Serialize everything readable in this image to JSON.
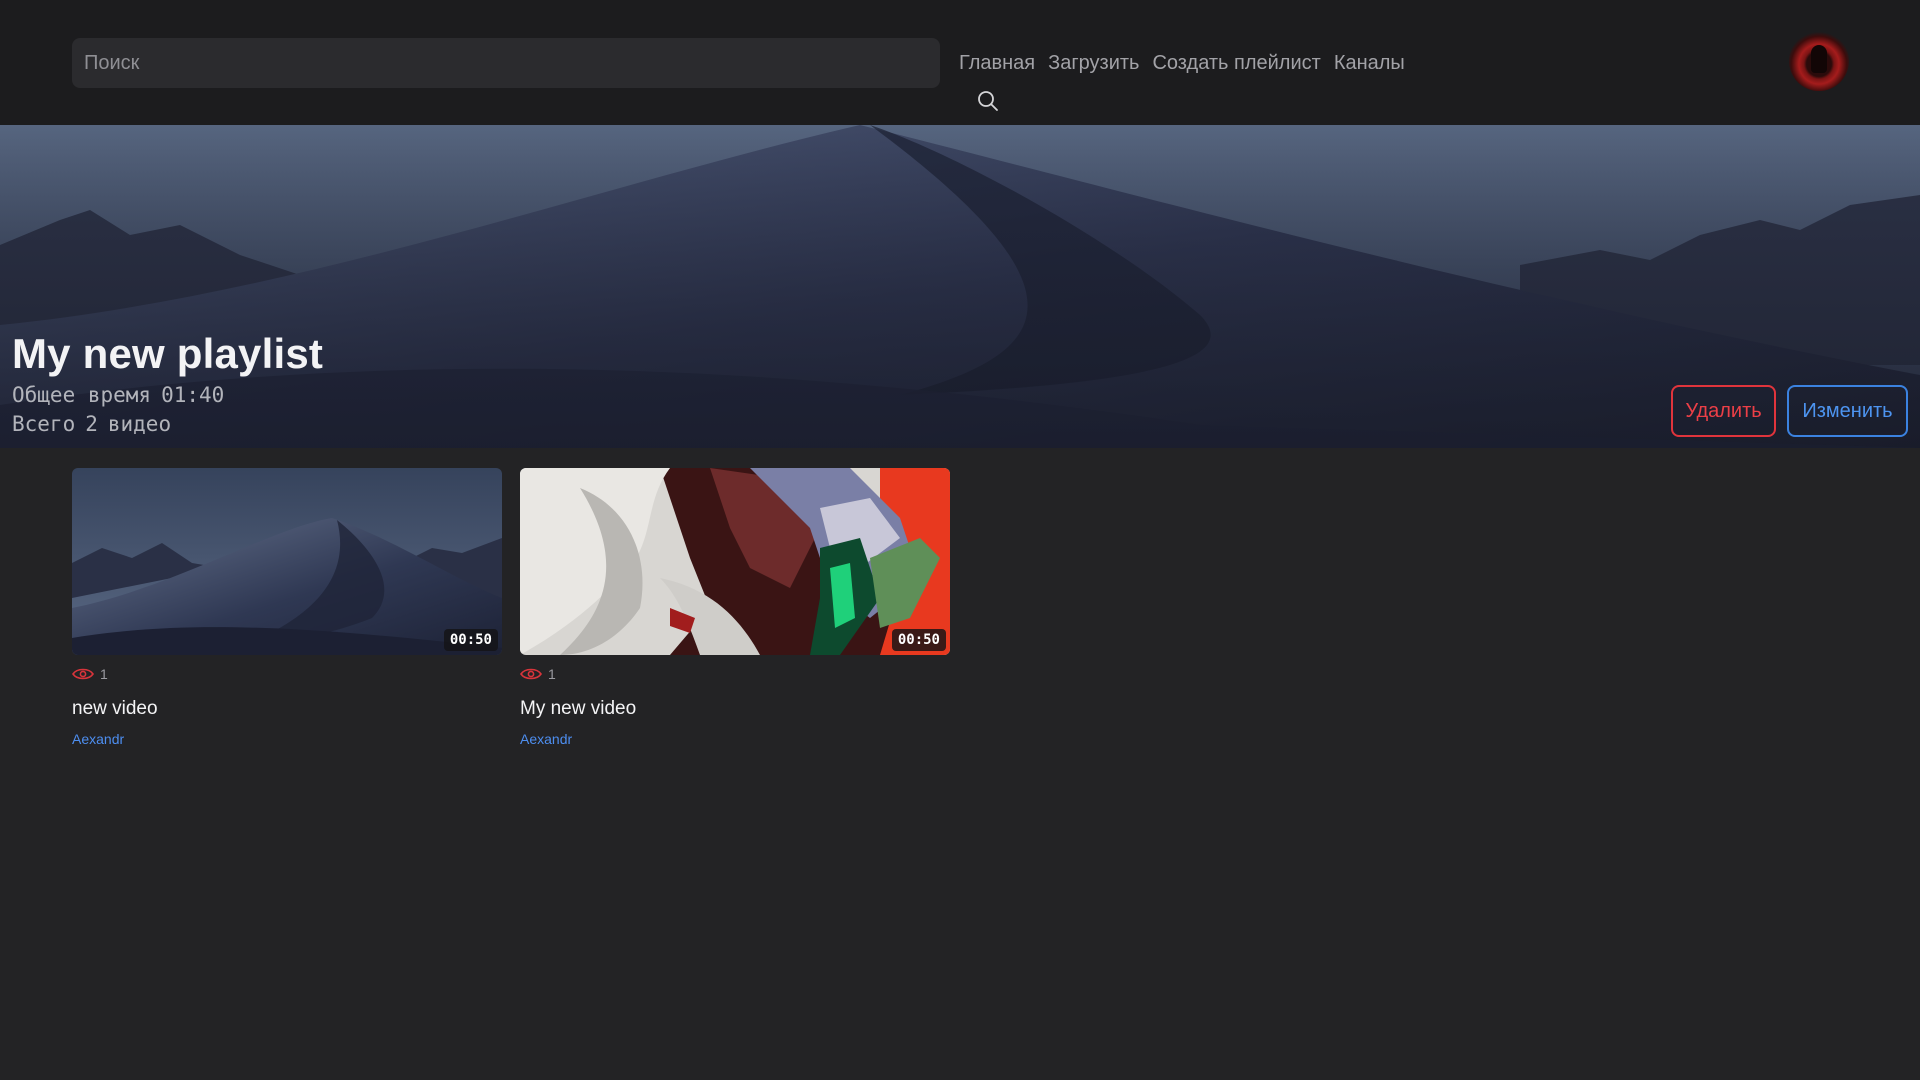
{
  "header": {
    "search": {
      "placeholder": "Поиск",
      "value": ""
    },
    "nav": [
      {
        "label": "Главная"
      },
      {
        "label": "Загрузить"
      },
      {
        "label": "Создать плейлист"
      },
      {
        "label": "Каналы"
      }
    ],
    "avatar_icon": "user-avatar"
  },
  "playlist": {
    "title": "My new playlist",
    "total_time_label": "Общее время",
    "total_time": "01:40",
    "count_label": "Всего",
    "count": "2",
    "count_unit": "видео",
    "delete_label": "Удалить",
    "edit_label": "Изменить"
  },
  "videos": [
    {
      "duration": "00:50",
      "views": "1",
      "title": "new video",
      "author": "Aexandr"
    },
    {
      "duration": "00:50",
      "views": "1",
      "title": "My new video",
      "author": "Aexandr"
    }
  ],
  "colors": {
    "background": "#232325",
    "header": "#1c1c1e",
    "delete_accent": "#e0343c",
    "edit_accent": "#3b82e0",
    "author_link": "#4d8ef0",
    "views_icon": "#d8343b"
  },
  "icons": {
    "search": "search-icon",
    "views": "eye-icon"
  }
}
